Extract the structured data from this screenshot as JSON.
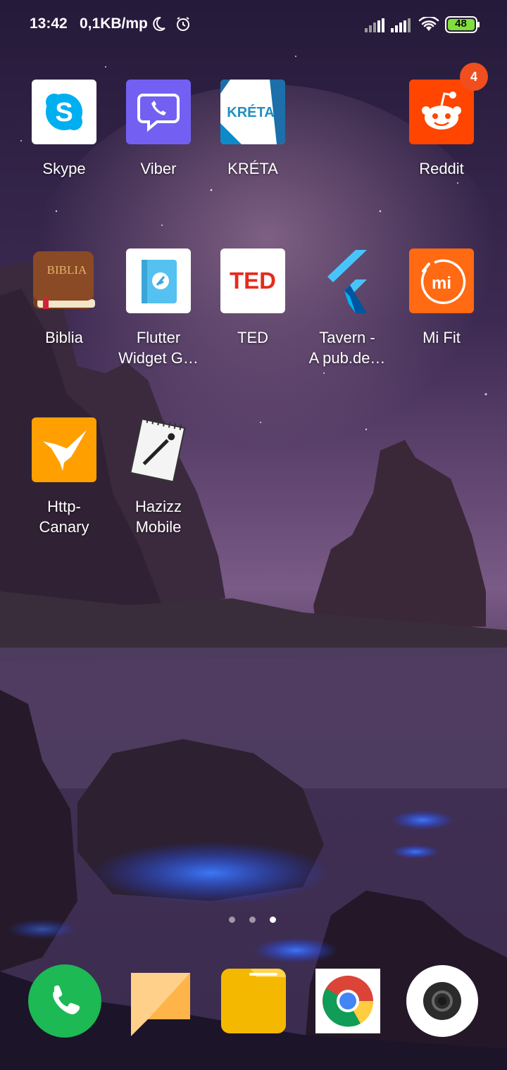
{
  "status_bar": {
    "time": "13:42",
    "network_rate": "0,1KB/mp",
    "battery_level": "48"
  },
  "home": {
    "apps": [
      {
        "label": "Skype",
        "icon": "skype-icon"
      },
      {
        "label": "Viber",
        "icon": "viber-icon"
      },
      {
        "label": "KRÉTA",
        "icon": "kreta-icon",
        "icon_text": "KRÉTA"
      },
      {
        "label": "Reddit",
        "icon": "reddit-icon",
        "badge": "4"
      },
      {
        "label": "Biblia",
        "icon": "biblia-icon",
        "icon_text": "BIBLIA"
      },
      {
        "label": "Flutter Widget G…",
        "label_line1": "Flutter",
        "label_line2": "Widget G…",
        "icon": "flutter-widget-guide-icon"
      },
      {
        "label": "TED",
        "icon": "ted-icon",
        "icon_text": "TED"
      },
      {
        "label": "Tavern - A pub.de…",
        "label_line1": "Tavern -",
        "label_line2": "A pub.de…",
        "icon": "flutter-logo-icon"
      },
      {
        "label": "Mi Fit",
        "icon": "mi-fit-icon",
        "icon_text": "mi"
      },
      {
        "label": "Http-Canary",
        "label_line1": "Http-",
        "label_line2": "Canary",
        "icon": "hummingbird-icon"
      },
      {
        "label": "Hazizz Mobile",
        "label_line1": "Hazizz",
        "label_line2": "Mobile",
        "icon": "notebook-icon"
      }
    ],
    "page_indicator": {
      "count": 3,
      "active": 3
    }
  },
  "dock": [
    {
      "name": "phone",
      "icon": "phone-icon"
    },
    {
      "name": "messages",
      "icon": "message-icon"
    },
    {
      "name": "files",
      "icon": "folder-icon"
    },
    {
      "name": "chrome",
      "icon": "chrome-icon"
    },
    {
      "name": "camera",
      "icon": "camera-icon"
    }
  ],
  "colors": {
    "skype": "#00aff0",
    "viber": "#7360f2",
    "reddit": "#ff4500",
    "mi_fit": "#ff6a13",
    "http_canary": "#ffa000",
    "phone": "#1db954",
    "messages": "#ffb74d",
    "files": "#ffc107",
    "badge": "#f04e1e"
  }
}
